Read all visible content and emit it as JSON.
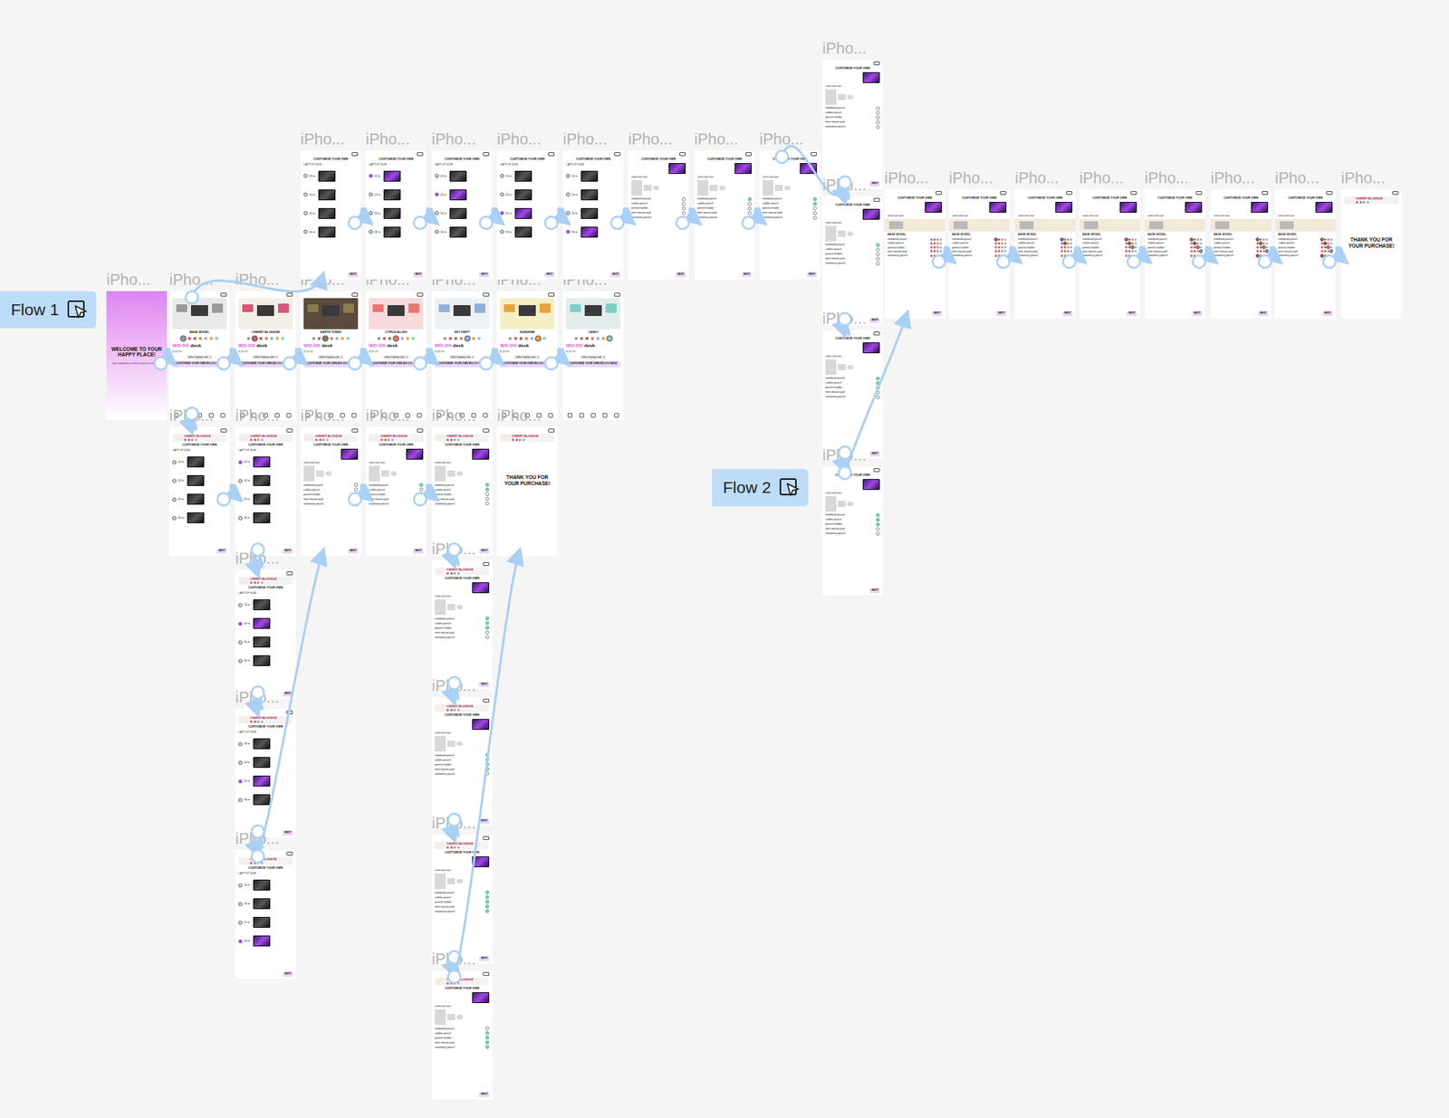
{
  "flows": [
    {
      "label": "Flow 1"
    },
    {
      "label": "Flow 2"
    }
  ],
  "common": {
    "welcome": "WELCOME TO YOUR HAPPY PLACE!",
    "welcome_sub": "click anywhere in the screen to continue",
    "customize_title": "CUSTOMIZE YOUR OWN",
    "laptop_size": "LAPTOP SIZE",
    "laptop_sizes": [
      "13 in",
      "14 in",
      "15 in",
      "16 in"
    ],
    "next": "NEXT",
    "selected_size": "selected size",
    "accessories": [
      "notebook pouch",
      "cables pouch",
      "pencils holder",
      "mini mouse pad",
      "stationery pouch"
    ],
    "base_model": "BASE MODEL",
    "thanks": "THANK YOU FOR YOUR PURCHASE!",
    "desk_brand": "WO-OO",
    "desk_word": "desk",
    "price": "$ 49.99",
    "select": "select laptop size",
    "select_caret": "▾",
    "desk_button": "CUSTOMIZE YOUR OWN WO-OO DESK"
  },
  "themes": [
    {
      "name": "BASE MODEL",
      "color": "#e9e9e9",
      "accent": "#9a9a9a"
    },
    {
      "name": "CHERRY BLOSSOM",
      "color": "#f4eee8",
      "accent": "#d9557a"
    },
    {
      "name": "EARTH TONES",
      "color": "#5b4b3c",
      "accent": "#8b7a4f"
    },
    {
      "name": "CITRUS BLUSH",
      "color": "#f8d9dc",
      "accent": "#e9786e"
    },
    {
      "name": "SKY DRIFT",
      "color": "#eef1f4",
      "accent": "#8fb1d9"
    },
    {
      "name": "SUNSHINE",
      "color": "#f6efc4",
      "accent": "#e8a33a"
    },
    {
      "name": "CANDY",
      "color": "#e3ecec",
      "accent": "#7ccfc5"
    }
  ],
  "frames": [
    {
      "label": "iPho...",
      "kind": "welcome"
    },
    {
      "label": "iPho...",
      "kind": "desk",
      "theme": 0
    },
    {
      "label": "iPho...",
      "kind": "desk",
      "theme": 1
    },
    {
      "label": "iPho...",
      "kind": "desk",
      "theme": 2
    },
    {
      "label": "iPho...",
      "kind": "desk",
      "theme": 3
    },
    {
      "label": "iPho...",
      "kind": "desk",
      "theme": 4
    },
    {
      "label": "iPho...",
      "kind": "desk",
      "theme": 5
    },
    {
      "label": "iPho...",
      "kind": "desk",
      "theme": 6
    },
    {
      "label": "iPho...",
      "kind": "laptop",
      "header": false,
      "theme": 1,
      "chosen": -1
    },
    {
      "label": "iPho...",
      "kind": "laptop",
      "header": false,
      "theme": 1,
      "chosen": 0
    },
    {
      "label": "iPho...",
      "kind": "laptop",
      "header": false,
      "theme": 1,
      "chosen": 1
    },
    {
      "label": "iPho...",
      "kind": "laptop",
      "header": false,
      "theme": 1,
      "chosen": 2
    },
    {
      "label": "iPho...",
      "kind": "laptop",
      "header": false,
      "theme": 1,
      "chosen": 3
    },
    {
      "label": "iPho...",
      "kind": "accessory",
      "header": false,
      "theme": 1,
      "checked": [
        false,
        false,
        false,
        false,
        false
      ]
    },
    {
      "label": "iPho...",
      "kind": "accessory",
      "header": false,
      "theme": 1,
      "checked": [
        true,
        false,
        false,
        false,
        false
      ]
    },
    {
      "label": "iPho...",
      "kind": "accessory",
      "header": false,
      "theme": 1,
      "checked": [
        true,
        true,
        false,
        false,
        false
      ]
    },
    {
      "label": "iPho...",
      "kind": "laptop",
      "header": true,
      "theme": 1,
      "chosen": -1
    },
    {
      "label": "iPho...",
      "kind": "laptop",
      "header": true,
      "theme": 1,
      "chosen": 0
    },
    {
      "label": "iPho...",
      "kind": "accessory",
      "header": true,
      "theme": 1,
      "checked": [
        false,
        false,
        false,
        false,
        false
      ]
    },
    {
      "label": "iPho...",
      "kind": "accessory",
      "header": true,
      "theme": 1,
      "checked": [
        true,
        false,
        false,
        false,
        false
      ]
    },
    {
      "label": "iPho...",
      "kind": "accessory",
      "header": true,
      "theme": 1,
      "checked": [
        true,
        true,
        false,
        false,
        false
      ]
    },
    {
      "label": "iPho...",
      "kind": "thanks",
      "theme": 1
    },
    {
      "label": "iPho...",
      "kind": "laptop",
      "header": true,
      "theme": 1,
      "chosen": 1
    },
    {
      "label": "iPho...",
      "kind": "laptop",
      "header": true,
      "theme": 1,
      "chosen": 2
    },
    {
      "label": "iPho...",
      "kind": "laptop",
      "header": true,
      "theme": 1,
      "chosen": 3
    },
    {
      "label": "iPho...",
      "kind": "accessory",
      "header": true,
      "theme": 1,
      "checked": [
        true,
        true,
        true,
        false,
        false
      ]
    },
    {
      "label": "iPho...",
      "kind": "accessory",
      "header": true,
      "theme": 1,
      "checked": [
        true,
        true,
        true,
        true,
        false
      ]
    },
    {
      "label": "iPho...",
      "kind": "accessory",
      "header": true,
      "theme": 1,
      "checked": [
        true,
        true,
        true,
        true,
        true
      ]
    },
    {
      "label": "iPho...",
      "kind": "accessory",
      "header": true,
      "theme": 1,
      "checked": [
        false,
        true,
        true,
        true,
        true
      ]
    },
    {
      "label": "iPho...",
      "kind": "accessory",
      "header": false,
      "theme": 1,
      "checked": [
        false,
        false,
        false,
        false,
        false
      ]
    },
    {
      "label": "iPho...",
      "kind": "accessory",
      "header": false,
      "theme": 1,
      "checked": [
        true,
        false,
        false,
        false,
        false
      ]
    },
    {
      "label": "iPho...",
      "kind": "accessory",
      "header": false,
      "theme": 1,
      "checked": [
        true,
        true,
        false,
        false,
        false
      ]
    },
    {
      "label": "iPho...",
      "kind": "accessory",
      "header": false,
      "theme": 1,
      "checked": [
        true,
        true,
        true,
        false,
        false
      ]
    },
    {
      "label": "iPho...",
      "kind": "palette",
      "picked": 0
    },
    {
      "label": "iPho...",
      "kind": "palette",
      "picked": 1
    },
    {
      "label": "iPho...",
      "kind": "palette",
      "picked": 2
    },
    {
      "label": "iPho...",
      "kind": "palette",
      "picked": 3
    },
    {
      "label": "iPho...",
      "kind": "palette",
      "picked": 4
    },
    {
      "label": "iPho...",
      "kind": "palette",
      "picked": 5
    },
    {
      "label": "iPho...",
      "kind": "palette",
      "picked": 5
    },
    {
      "label": "iPho...",
      "kind": "thanks",
      "theme": 1
    }
  ],
  "links": [
    [
      0,
      1
    ],
    [
      1,
      2
    ],
    [
      2,
      3
    ],
    [
      3,
      4
    ],
    [
      4,
      5
    ],
    [
      5,
      6
    ],
    [
      6,
      7
    ],
    [
      1,
      8
    ],
    [
      8,
      9
    ],
    [
      9,
      10
    ],
    [
      10,
      11
    ],
    [
      11,
      12
    ],
    [
      12,
      13
    ],
    [
      13,
      14
    ],
    [
      14,
      15
    ],
    [
      15,
      29
    ],
    [
      29,
      30
    ],
    [
      30,
      31
    ],
    [
      31,
      32
    ],
    [
      32,
      33
    ],
    [
      33,
      34
    ],
    [
      34,
      35
    ],
    [
      35,
      36
    ],
    [
      36,
      37
    ],
    [
      37,
      38
    ],
    [
      38,
      39
    ],
    [
      39,
      40
    ],
    [
      1,
      16
    ],
    [
      16,
      17
    ],
    [
      17,
      22
    ],
    [
      22,
      23
    ],
    [
      23,
      24
    ],
    [
      24,
      18
    ],
    [
      18,
      19
    ],
    [
      19,
      20
    ],
    [
      20,
      25
    ],
    [
      25,
      26
    ],
    [
      26,
      27
    ],
    [
      27,
      28
    ],
    [
      28,
      21
    ]
  ]
}
